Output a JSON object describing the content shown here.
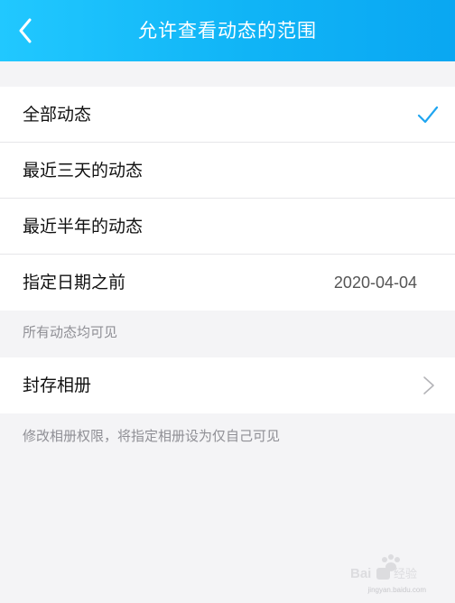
{
  "header": {
    "title": "允许查看动态的范围",
    "back_icon": "back-arrow-icon",
    "bg_start": "#21c8ff",
    "bg_end": "#0aa7f2"
  },
  "options": [
    {
      "label": "全部动态",
      "selected": true
    },
    {
      "label": "最近三天的动态",
      "selected": false
    },
    {
      "label": "最近半年的动态",
      "selected": false
    },
    {
      "label": "指定日期之前",
      "value": "2020-04-04",
      "selected": false
    }
  ],
  "options_hint": "所有动态均可见",
  "archive": {
    "label": "封存相册",
    "icon": "chevron-right-icon",
    "hint": "修改相册权限，将指定相册设为仅自己可见"
  },
  "watermark": {
    "text": "Bai经验",
    "url": "jingyan.baidu.com"
  },
  "colors": {
    "accent": "#1fa5f0",
    "background": "#f4f4f6"
  }
}
